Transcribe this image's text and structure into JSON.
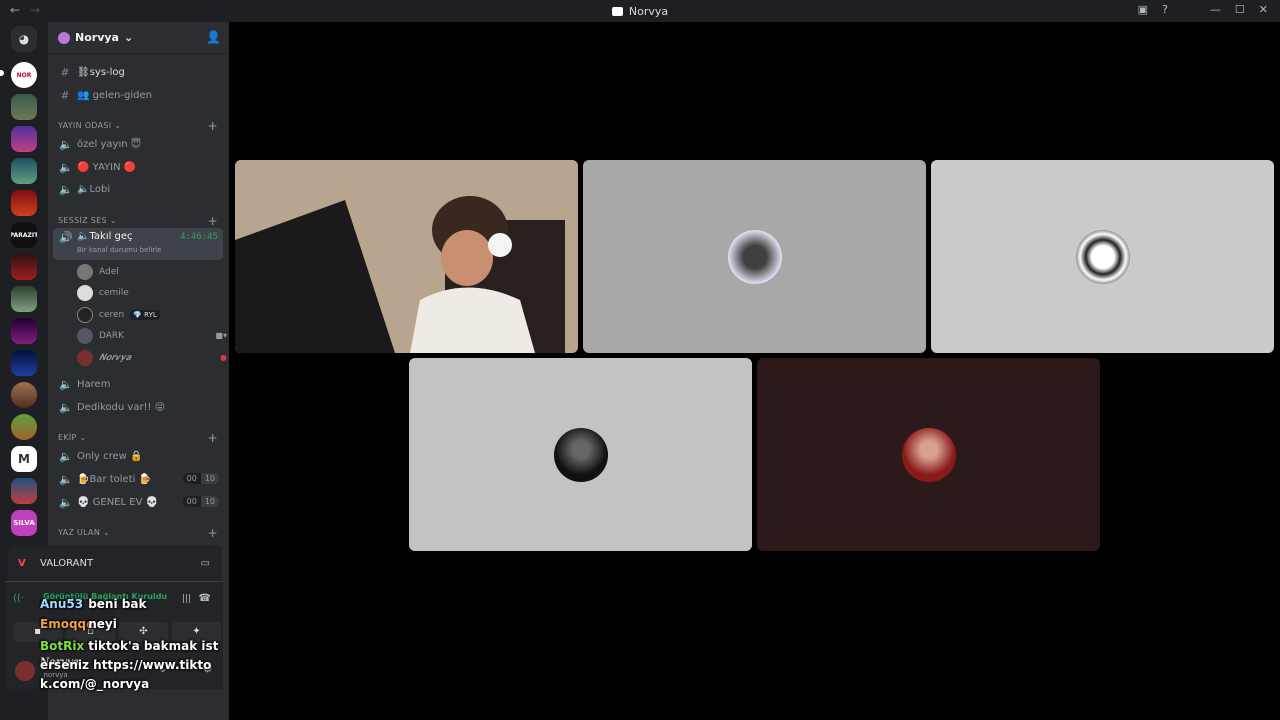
{
  "window": {
    "title": "Norvya"
  },
  "server": {
    "name": "Norvya"
  },
  "channels_top": [
    {
      "name": "⛓sys-log",
      "icon": "#"
    },
    {
      "name": "👥 gelen-giden",
      "icon": "#"
    }
  ],
  "categories": {
    "yayin": "YAYIN ODASI",
    "sessiz": "SESSİZ SES",
    "ekip": "EKİP",
    "yaz": "YAZ ULAN"
  },
  "yayin_channels": [
    "özel yayın 😇",
    "🔴 YAYIN 🔴",
    "🔈Lobi"
  ],
  "active_channel": {
    "name": "🔈Takıl geç",
    "timer": "4:46:45",
    "status": "Bir kanal durumu belirle"
  },
  "voice_users": [
    {
      "name": "Adel",
      "badge": ""
    },
    {
      "name": "cemile",
      "badge": ""
    },
    {
      "name": "ceren",
      "badge": "💎 RYL"
    },
    {
      "name": "DARK",
      "badge": ""
    },
    {
      "name": "𝑵𝒐𝒓𝒗𝒚𝒂",
      "badge": ""
    }
  ],
  "sessiz_channels": [
    "Harem",
    "Dedikodu var!! 😜"
  ],
  "ekip_channels": [
    {
      "name": "Only crew 🔒",
      "counts": null
    },
    {
      "name": "🍺Bar toleti 🍺",
      "counts": [
        "00",
        "10"
      ]
    },
    {
      "name": "💀 GENEL EV 💀",
      "counts": [
        "00",
        "10"
      ]
    }
  ],
  "activity": {
    "game": "VALORANT"
  },
  "voice_panel": {
    "status": "Görüntülü Bağlantı Kuruldu"
  },
  "user": {
    "display": "𝑵𝒐𝒓𝒗𝒚𝒂",
    "tag": "_norvya"
  },
  "chat_overlay": [
    {
      "name": "Anu53",
      "text": "beni bak",
      "color": "#a5d8ff"
    },
    {
      "name": "Emoqqe",
      "text": "neyi",
      "color": "#f0a040"
    },
    {
      "name": "BotRix",
      "text": "tiktok'a bakmak isterseniz https://www.tiktok.com/@_norvya",
      "color": "#7ee03a"
    }
  ],
  "guild_labels": {
    "parazit": "PARAZIT",
    "silva": "SILVA",
    "m": "M"
  },
  "colors": {
    "accent": "#5865f2",
    "online": "#23a55a",
    "bg": "#2b2d31"
  }
}
